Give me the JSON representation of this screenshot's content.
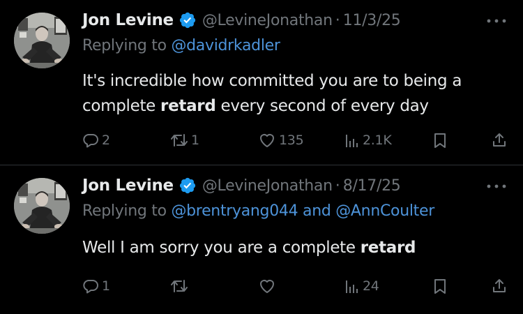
{
  "theme": {
    "background": "#000000",
    "primary_text": "#e7e9ea",
    "secondary_text": "#71767b",
    "link": "#4d93d9",
    "verified_badge": "#1d9bf0",
    "divider": "#2f3336"
  },
  "tweets": [
    {
      "author_name": "Jon Levine",
      "handle": "@LevineJonathan",
      "separator": "·",
      "date": "11/3/25",
      "replying_to_label": "Replying to",
      "mentions": [
        "@davidrkadler"
      ],
      "mention_joiner": "",
      "text_before": "It's incredible how committed you are to being a complete ",
      "text_bold": "retard",
      "text_after": " every second of every day",
      "replies": "2",
      "reposts": "1",
      "likes": "135",
      "views": "2.1K"
    },
    {
      "author_name": "Jon Levine",
      "handle": "@LevineJonathan",
      "separator": "·",
      "date": "8/17/25",
      "replying_to_label": "Replying to",
      "mentions": [
        "@brentryang044",
        "@AnnCoulter"
      ],
      "mention_joiner": "and",
      "text_before": "Well I am sorry you are a complete ",
      "text_bold": "retard",
      "text_after": "",
      "replies": "1",
      "reposts": "",
      "likes": "",
      "views": "24"
    }
  ],
  "icons": {
    "avatar": "profile-photo",
    "verified": "verified-checkmark-badge",
    "more": "more-horizontal-dots",
    "reply": "speech-bubble",
    "repost": "repost-arrows",
    "like": "heart-outline",
    "views": "bar-chart",
    "bookmark": "bookmark",
    "share": "share-upload-arrow"
  }
}
